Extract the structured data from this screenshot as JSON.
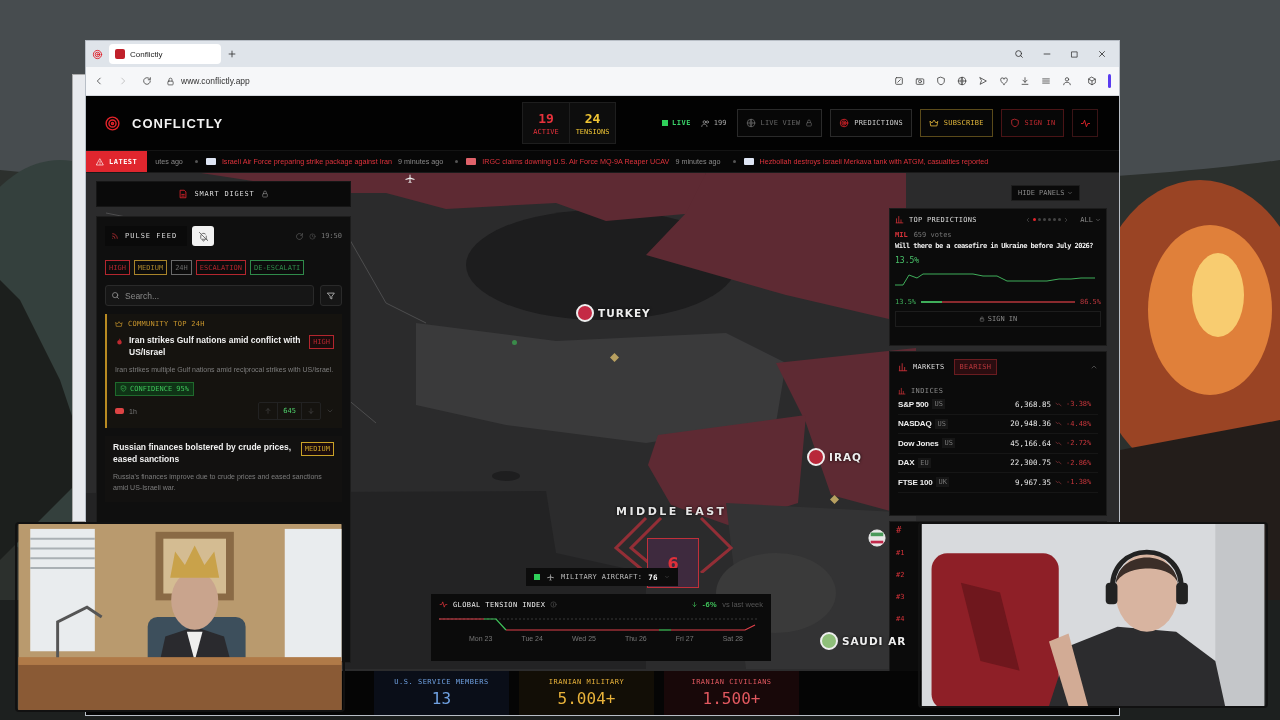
{
  "browser": {
    "tab_title": "Conflictly",
    "url": "www.conflictly.app"
  },
  "header": {
    "brand": "CONFLICTLY",
    "stats": [
      {
        "value": "19",
        "label": "ACTIVE",
        "color": "#e8323c"
      },
      {
        "value": "24",
        "label": "TENSIONS",
        "color": "#f0c534"
      }
    ],
    "live": "LIVE",
    "viewers": "199",
    "nav": [
      {
        "kind": "live_view",
        "label": "LIVE VIEW"
      },
      {
        "kind": "predictions",
        "label": "PREDICTIONS"
      },
      {
        "kind": "subscribe",
        "label": "SUBSCRIBE"
      },
      {
        "kind": "sign_in",
        "label": "SIGN IN"
      }
    ]
  },
  "ticker": {
    "badge": "LATEST",
    "items": [
      {
        "time": "utes ago"
      },
      {
        "headline": "Israeli Air Force preparing strike package against Iran",
        "time": "9 minutes ago",
        "color": "#dfe6f5"
      },
      {
        "headline": "IRGC claims downing U.S. Air Force MQ-9A Reaper UCAV",
        "time": "9 minutes ago",
        "color": "#e0626a"
      },
      {
        "headline": "Hezbollah destroys Israeli Merkava tank with ATGM, casualties reported",
        "color": "#dfe6f5"
      }
    ]
  },
  "digest": {
    "label": "SMART DIGEST"
  },
  "feed": {
    "title": "PULSE FEED",
    "muted": true,
    "time": "19:50",
    "search": {
      "placeholder": "Search..."
    },
    "filters": [
      {
        "label": "HIGH",
        "color": "#b3262e"
      },
      {
        "label": "MEDIUM",
        "color": "#a8842a"
      },
      {
        "label": "24H",
        "color": "#6a6a6a"
      },
      {
        "label": "ESCALATION",
        "color": "#b3262e"
      },
      {
        "label": "DE-ESCALATI",
        "color": "#2f8a4a"
      }
    ],
    "cards": [
      {
        "kind": "community",
        "tag": "COMMUNITY TOP 24H",
        "title": "Iran strikes Gulf nations amid conflict with US/Israel",
        "badge": {
          "label": "HIGH",
          "color": "#b3262e"
        },
        "summary": "Iran strikes multiple Gulf nations amid reciprocal strikes with US/Israel.",
        "confidence": "CONFIDENCE 95%",
        "age": "1h",
        "votes": "645"
      },
      {
        "kind": "plain",
        "title": "Russian finances bolstered by crude prices, eased sanctions",
        "badge": {
          "label": "MEDIUM",
          "color": "#c9a227"
        },
        "summary": "Russia's finances improve due to crude prices and eased sanctions amid US-Israeli war."
      }
    ]
  },
  "predictions": {
    "title": "TOP PREDICTIONS",
    "pages": [
      {
        "selected": true
      },
      {
        "selected": false
      },
      {
        "selected": false
      },
      {
        "selected": false
      },
      {
        "selected": false
      },
      {
        "selected": false
      }
    ],
    "filter": "ALL",
    "category": "MIL",
    "votes": "659 votes",
    "question": "Will there be a ceasefire in Ukraine before July 2026?",
    "chance": "13.5%",
    "yes": "13.5%",
    "no": "86.5%",
    "level": 0.135,
    "action": "SIGN IN"
  },
  "markets": {
    "title": "MARKETS",
    "mood": "BEARISH",
    "group": "INDICES",
    "rows": [
      {
        "name": "S&P 500",
        "region": "US",
        "value": "6,368.85",
        "change": "-3.38%"
      },
      {
        "name": "NASDAQ",
        "region": "US",
        "value": "20,948.36",
        "change": "-4.48%"
      },
      {
        "name": "Dow Jones",
        "region": "US",
        "value": "45,166.64",
        "change": "-2.72%"
      },
      {
        "name": "DAX",
        "region": "EU",
        "value": "22,300.75",
        "change": "-2.86%"
      },
      {
        "name": "FTSE 100",
        "region": "UK",
        "value": "9,967.35",
        "change": "-1.38%"
      }
    ]
  },
  "ranks": {
    "header": "#",
    "items": [
      "#1",
      "#2",
      "#3",
      "#4"
    ]
  },
  "map": {
    "hide_panels": "HIDE PANELS",
    "cluster": "6",
    "labels": [
      {
        "kind": "country",
        "text": "TURKEY",
        "color": "#c42a45"
      },
      {
        "kind": "country",
        "text": "IRAQ",
        "color": "#b8283a"
      },
      {
        "kind": "region",
        "text": "MIDDLE EAST"
      },
      {
        "kind": "country",
        "text": "SAUDI AR",
        "color": "#8fbf7a"
      }
    ],
    "aircraft": {
      "label": "MILITARY AIRCRAFT:",
      "count": "76"
    }
  },
  "tension": {
    "title": "GLOBAL TENSION INDEX",
    "change": "-6%",
    "note": "vs last week",
    "days": [
      "Mon 23",
      "Tue 24",
      "Wed 25",
      "Thu 26",
      "Fri 27",
      "Sat 28"
    ]
  },
  "casualties": [
    {
      "label": "U.S. SERVICE MEMBERS",
      "value": "13",
      "color": "#6fa0e0"
    },
    {
      "label": "IRANIAN MILITARY",
      "value": "5.004+",
      "color": "#e8b23a"
    },
    {
      "label": "IRANIAN CIVILIANS",
      "value": "1.500+",
      "color": "#e0585f"
    }
  ]
}
